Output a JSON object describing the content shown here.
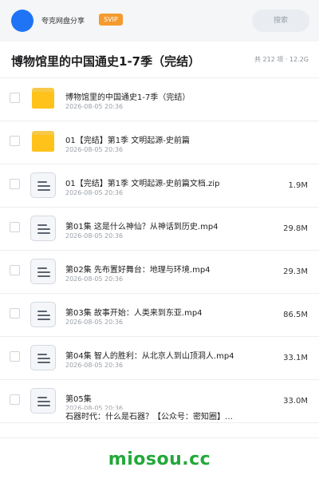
{
  "header": {
    "brand": "夸克网盘分享",
    "badge": "SVIP",
    "search_placeholder": "搜索"
  },
  "share": {
    "title": "博物馆里的中国通史1-7季（完结）",
    "summary": "共 212 项 · 12.2G"
  },
  "files": [
    {
      "type": "folder",
      "name": "博物馆里的中国通史1-7季（完结）",
      "date": "2026-08-05 20:36",
      "size": ""
    },
    {
      "type": "folder",
      "name": "01【完结】第1季 文明起源-史前篇",
      "date": "2026-08-05 20:36",
      "size": ""
    },
    {
      "type": "file",
      "name": "01【完结】第1季 文明起源-史前篇文档.zip",
      "date": "2026-08-05 20:36",
      "size": "1.9M"
    },
    {
      "type": "file",
      "name": "第01集 这是什么神仙？从神话到历史.mp4",
      "date": "2026-08-05 20:36",
      "size": "29.8M"
    },
    {
      "type": "file",
      "name": "第02集 先布置好舞台：地理与环境.mp4",
      "date": "2026-08-05 20:36",
      "size": "29.3M"
    },
    {
      "type": "file",
      "name": "第03集 故事开始：人类来到东亚.mp4",
      "date": "2026-08-05 20:36",
      "size": "86.5M"
    },
    {
      "type": "file",
      "name": "第04集 智人的胜利：从北京人到山顶洞人.mp4",
      "date": "2026-08-05 20:36",
      "size": "33.1M"
    },
    {
      "type": "file",
      "name": "第05集",
      "name_line2": "石器时代：什么是石器？【公众号：密知圈】…",
      "date": "2026-08-05 20:36",
      "size": "33.0M"
    }
  ],
  "watermark": "miosou.cc"
}
